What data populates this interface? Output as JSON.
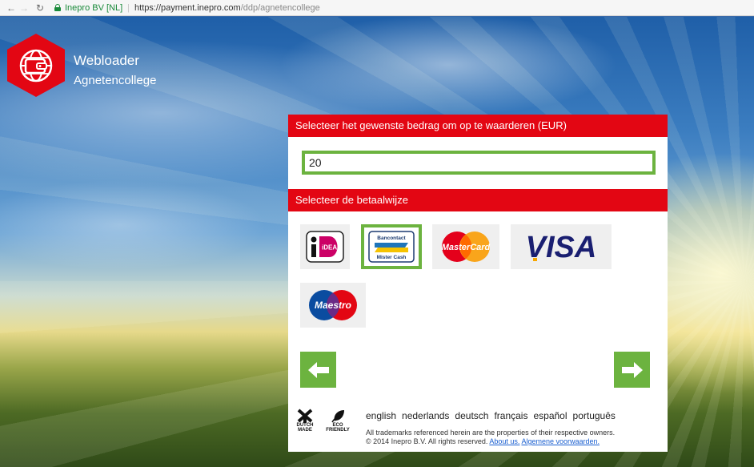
{
  "browser": {
    "site_name": "Inepro BV [NL]",
    "separator": "|",
    "url_host": "https://payment.inepro.com",
    "url_path": "/ddp/agnetencollege"
  },
  "brand": {
    "title": "Webloader",
    "subtitle": "Agnetencollege",
    "color": "#e30613"
  },
  "amount_section": {
    "heading": "Selecteer het gewenste bedrag om op te waarderen (EUR)",
    "value": "20"
  },
  "payment_section": {
    "heading": "Selecteer de betaalwijze",
    "methods": [
      {
        "name": "iDEAL",
        "selected": false,
        "logo_text": "iDEAL"
      },
      {
        "name": "Bancontact Mister Cash",
        "selected": true,
        "logo_text_top": "Bancontact",
        "logo_text_bottom": "Mister Cash"
      },
      {
        "name": "MasterCard",
        "selected": false,
        "logo_text": "MasterCard"
      },
      {
        "name": "VISA",
        "selected": false,
        "logo_text": "VISA"
      },
      {
        "name": "Maestro",
        "selected": false,
        "logo_text": "Maestro"
      }
    ]
  },
  "navigation": {
    "back_icon": "arrow-left-icon",
    "next_icon": "arrow-right-icon",
    "accent": "#6cb33f"
  },
  "footer": {
    "badge_dutch_line1": "DUTCH",
    "badge_dutch_line2": "MADE",
    "badge_eco_line1": "ECO",
    "badge_eco_line2": "FRIENDLY",
    "languages": [
      "english",
      "nederlands",
      "deutsch",
      "français",
      "español",
      "português"
    ],
    "trademark_text": "All trademarks referenced herein are the properties of their respective owners.",
    "copyright_text": "© 2014 Inepro B.V. All rights reserved.",
    "about_link": "About us.",
    "terms_link": "Algemene voorwaarden."
  }
}
